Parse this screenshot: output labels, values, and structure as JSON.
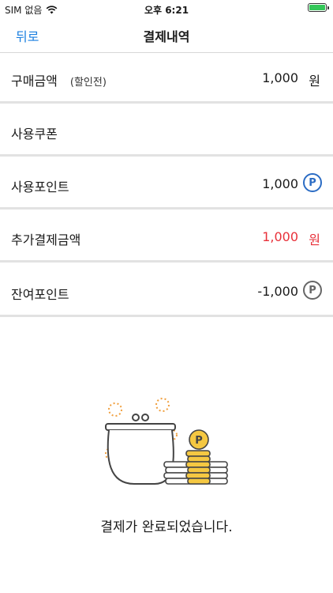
{
  "status_bar": {
    "carrier": "SIM 없음",
    "time": "오후 6:21"
  },
  "nav": {
    "back_label": "뒤로",
    "title": "결제내역"
  },
  "rows": [
    {
      "label": "구매금액",
      "sublabel": "(할인전)",
      "value": "1,000",
      "unit": "원"
    },
    {
      "label": "사용쿠폰"
    },
    {
      "label": "사용포인트",
      "value": "1,000",
      "icon": "P"
    },
    {
      "label": "추가결제금액",
      "value": "1,000",
      "unit": "원",
      "color": "#e8313a"
    },
    {
      "label": "잔여포인트",
      "value": "-1,000",
      "icon": "P"
    }
  ],
  "illustration": {
    "coin_label": "P"
  },
  "message": "결제가 완료되었습니다.",
  "colors": {
    "accent": "#1a7fe0",
    "point_icon": "#2b6cc4",
    "alert": "#e8313a",
    "battery": "#34c759"
  }
}
